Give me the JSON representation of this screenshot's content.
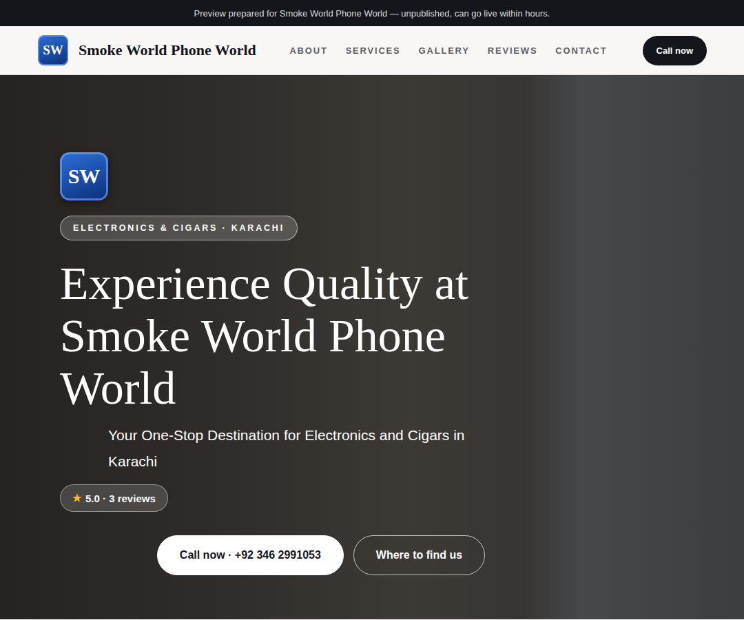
{
  "banner": {
    "text": "Preview prepared for Smoke World Phone World — unpublished, can go live within hours."
  },
  "brand": {
    "initials": "SW",
    "name": "Smoke World Phone World"
  },
  "nav": {
    "links": [
      "ABOUT",
      "SERVICES",
      "GALLERY",
      "REVIEWS",
      "CONTACT"
    ],
    "cta": "Call now"
  },
  "hero": {
    "logo": "SW",
    "badge": "ELECTRONICS & CIGARS · KARACHI",
    "title": "Experience Quality at Smoke World Phone World",
    "subtitle": "Your One-Stop Destination for Electronics and Cigars in Karachi",
    "rating": {
      "star": "★",
      "text": "5.0 · 3 reviews"
    },
    "buttons": [
      {
        "label": "Call now · +92 346 2991053",
        "kind": "solid"
      },
      {
        "label": "Where to find us",
        "kind": "outline"
      }
    ]
  }
}
